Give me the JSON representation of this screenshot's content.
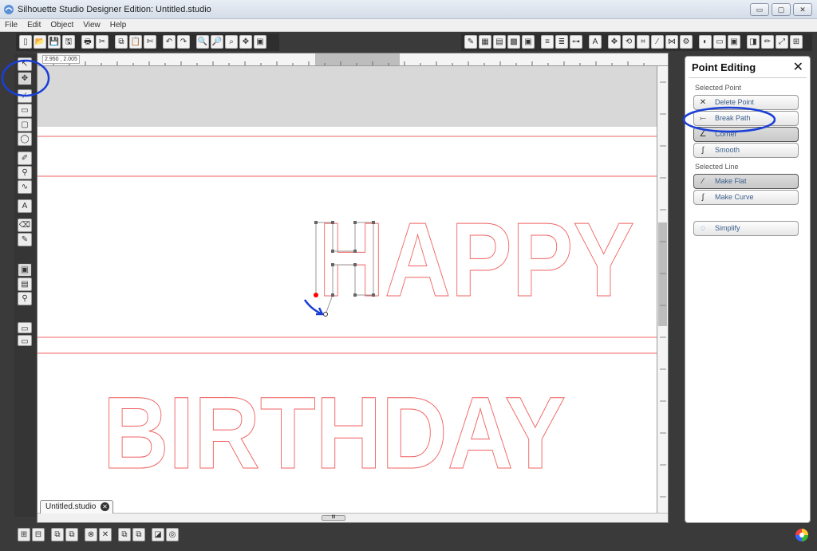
{
  "window": {
    "title": "Silhouette Studio Designer Edition: Untitled.studio",
    "buttons": [
      "▭",
      "▢",
      "✕"
    ]
  },
  "menubar": {
    "items": [
      "File",
      "Edit",
      "Object",
      "View",
      "Help"
    ]
  },
  "toolbar_left": {
    "icons": [
      "new-icon",
      "open-icon",
      "save-icon",
      "save-as-icon",
      "print-icon",
      "cut-send-icon",
      "copy-icon",
      "paste-icon",
      "scissors-icon",
      "undo-icon",
      "redo-icon",
      "zoom-in-icon",
      "zoom-out-icon",
      "zoom-select-icon",
      "pan-icon",
      "fit-page-icon"
    ],
    "glyphs": [
      "▯",
      "📂",
      "💾",
      "🖫",
      "🖶",
      "✂",
      "⧉",
      "📋",
      "✄",
      "↶",
      "↷",
      "🔍",
      "🔎",
      "⌕",
      "✥",
      "▣"
    ]
  },
  "toolbar_right": {
    "glyphs": [
      "✎",
      "▦",
      "▤",
      "▩",
      "▣",
      "≡",
      "≣",
      "⊶",
      "A",
      "✥",
      "⟲",
      "⌗",
      "∕",
      "⋈",
      "⚙",
      "◐",
      "▭",
      "▣",
      "◨",
      "✏",
      "⤢",
      "⊞"
    ]
  },
  "coords": {
    "readout": "2.950 , 2.005"
  },
  "left_tools": {
    "glyphs": [
      "↖",
      "✥",
      "∕",
      "▭",
      "▢",
      "◯",
      "✐",
      "⚲",
      "∿",
      "A",
      "⌫",
      "✎",
      "▣",
      "▤",
      "⚲",
      "▭",
      "▭"
    ]
  },
  "canvas": {
    "word1": "HAPPY",
    "word2": "BIRTHDAY",
    "line_color": "#f06060"
  },
  "document_tab": {
    "label": "Untitled.studio",
    "close": "✕"
  },
  "scroll": {
    "thumb": "III"
  },
  "panel": {
    "title": "Point Editing",
    "close": "✕",
    "selected_point_label": "Selected Point",
    "selected_line_label": "Selected Line",
    "buttons": {
      "delete_point": "Delete Point",
      "break_path": "Break Path",
      "corner": "Corner",
      "smooth": "Smooth",
      "make_flat": "Make Flat",
      "make_curve": "Make Curve",
      "simplify": "Simplify"
    },
    "glyphs": {
      "delete_point": "✕",
      "break_path": "⤚",
      "corner": "∠",
      "smooth": "∫",
      "make_flat": "∕",
      "make_curve": "∫",
      "simplify": "◌"
    }
  },
  "bottom_tools": {
    "glyphs": [
      "⊞",
      "⊟",
      "⧉",
      "⧉",
      "⊗",
      "✕",
      "⧉",
      "⧉",
      "◪",
      "◎"
    ]
  },
  "annotation_color": "#1a3fd6"
}
